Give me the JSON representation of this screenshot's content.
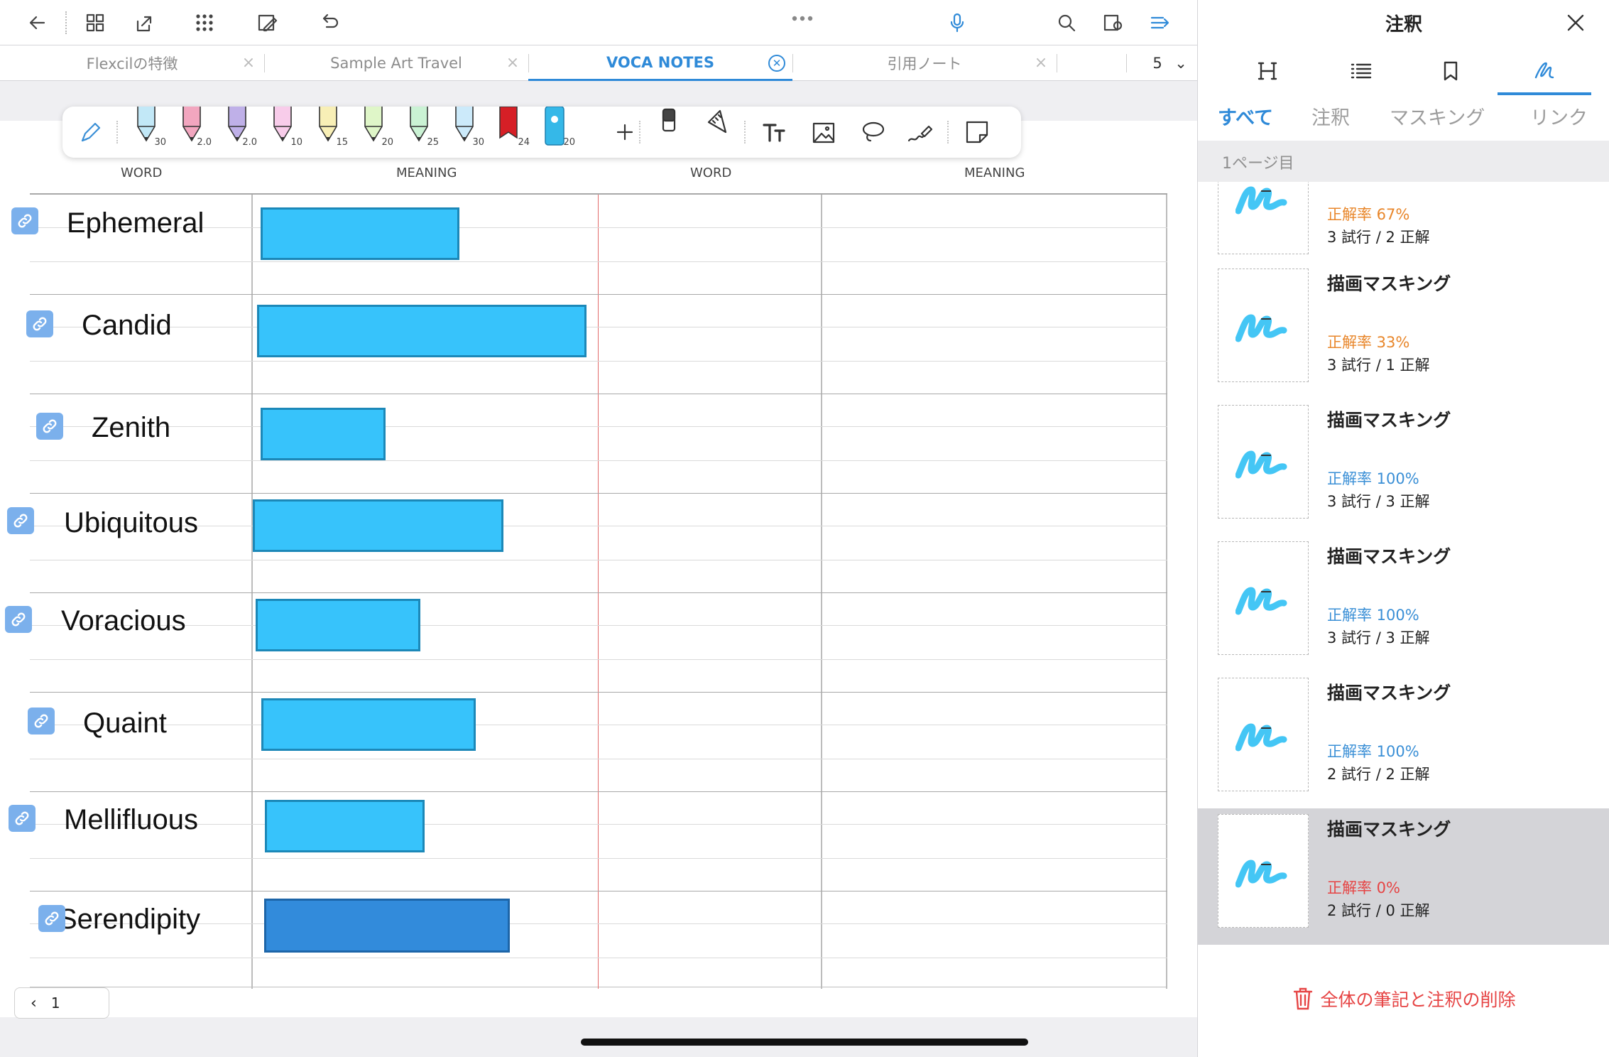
{
  "tabs": [
    {
      "label": "Flexcilの特徴",
      "active": false
    },
    {
      "label": "Sample Art Travel",
      "active": false
    },
    {
      "label": "VOCA NOTES",
      "active": true
    },
    {
      "label": "引用ノート",
      "active": false
    }
  ],
  "tab_count": "5",
  "pens": [
    {
      "size": "30",
      "color": "#8fd6f0"
    },
    {
      "size": "2.0",
      "color": "#e85c8a"
    },
    {
      "size": "2.0",
      "color": "#8b6fd6"
    },
    {
      "size": "10",
      "color": "#f2a3d8"
    },
    {
      "size": "15",
      "color": "#f2e27a"
    },
    {
      "size": "20",
      "color": "#c4ee9a"
    },
    {
      "size": "25",
      "color": "#9ee7b0"
    },
    {
      "size": "30",
      "color": "#a3d9f5"
    },
    {
      "size": "24",
      "color": "#d61f26"
    },
    {
      "size": "20",
      "color": "#35b8e8"
    }
  ],
  "columns": [
    "WORD",
    "MEANING",
    "WORD",
    "MEANING"
  ],
  "words": [
    "Ephemeral",
    "Candid",
    "Zenith",
    "Ubiquitous",
    "Voracious",
    "Quaint",
    "Mellifluous",
    "Serendipity"
  ],
  "pager": {
    "page": "1"
  },
  "panel": {
    "title": "注釈",
    "filters": [
      "すべて",
      "注釈",
      "マスキング",
      "リンク"
    ],
    "section": "1ページ目",
    "entries": [
      {
        "title": "",
        "rate": "正解率 67%",
        "trials": "3 試行 / 2 正解",
        "rate_color": "#e8862a"
      },
      {
        "title": "描画マスキング",
        "rate": "正解率 33%",
        "trials": "3 試行 / 1 正解",
        "rate_color": "#e8862a"
      },
      {
        "title": "描画マスキング",
        "rate": "正解率 100%",
        "trials": "3 試行 / 3 正解",
        "rate_color": "#3a8fd6"
      },
      {
        "title": "描画マスキング",
        "rate": "正解率 100%",
        "trials": "3 試行 / 3 正解",
        "rate_color": "#3a8fd6"
      },
      {
        "title": "描画マスキング",
        "rate": "正解率 100%",
        "trials": "2 試行 / 2 正解",
        "rate_color": "#3a8fd6"
      },
      {
        "title": "描画マスキング",
        "rate": "正解率 0%",
        "trials": "2 試行 / 0 正解",
        "rate_color": "#e64444"
      }
    ],
    "delete_label": "全体の筆記と注釈の削除"
  },
  "colors": {
    "accent": "#2f8ad8",
    "mask": "#37c3fb",
    "mask_selected": "#328bdb",
    "danger": "#e64444"
  }
}
